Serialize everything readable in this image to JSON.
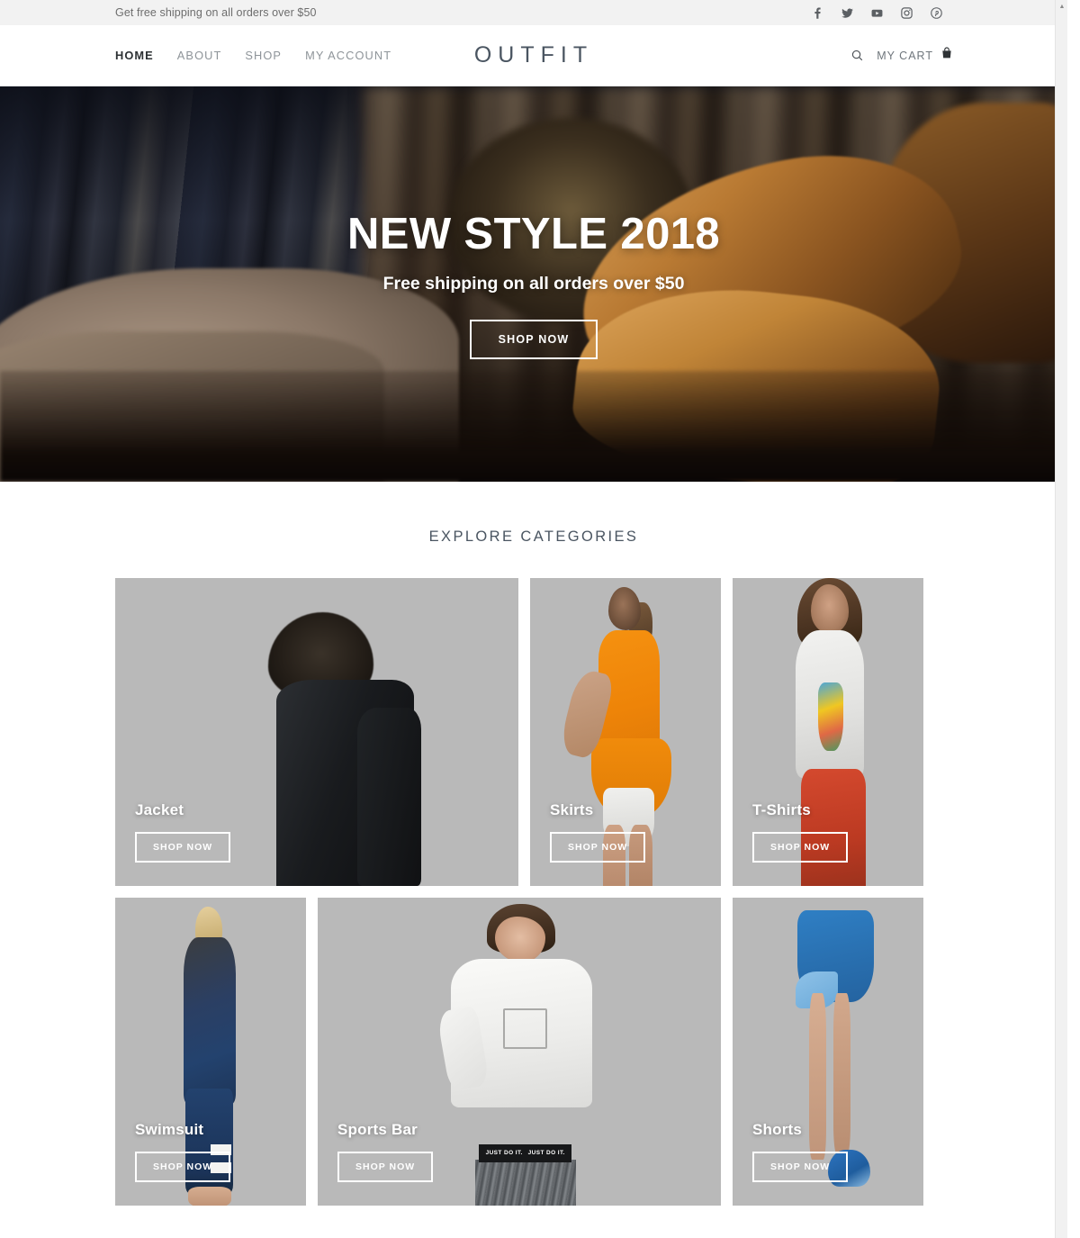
{
  "topbar": {
    "message": "Get free shipping on all orders over $50",
    "social": [
      {
        "name": "facebook-icon",
        "label": "f"
      },
      {
        "name": "twitter-icon",
        "label": "t"
      },
      {
        "name": "youtube-icon",
        "label": "yt"
      },
      {
        "name": "instagram-icon",
        "label": "ig"
      },
      {
        "name": "pinterest-icon",
        "label": "p"
      }
    ]
  },
  "nav": {
    "logo": "OUTFIT",
    "links": [
      {
        "label": "HOME",
        "active": true
      },
      {
        "label": "ABOUT",
        "active": false
      },
      {
        "label": "SHOP",
        "active": false
      },
      {
        "label": "MY ACCOUNT",
        "active": false
      }
    ],
    "search_label": "search-icon",
    "cart_label": "MY CART"
  },
  "hero": {
    "title": "NEW STYLE 2018",
    "subtitle": "Free shipping on all orders over $50",
    "button": "SHOP NOW"
  },
  "categories_section": {
    "title": "EXPLORE CATEGORIES",
    "row1": [
      {
        "label": "Jacket",
        "button": "SHOP NOW",
        "size": "wide"
      },
      {
        "label": "Skirts",
        "button": "SHOP NOW",
        "size": "narrow"
      },
      {
        "label": "T-Shirts",
        "button": "SHOP NOW",
        "size": "narrow"
      }
    ],
    "row2": [
      {
        "label": "Swimsuit",
        "button": "SHOP NOW",
        "size": "narrow"
      },
      {
        "label": "Sports Bar",
        "button": "SHOP NOW",
        "size": "wide"
      },
      {
        "label": "Shorts",
        "button": "SHOP NOW",
        "size": "narrow"
      }
    ]
  },
  "colors": {
    "topbar_bg": "#f2f2f2",
    "logo": "#4a5561",
    "nav_active": "#2c3033",
    "nav_inactive": "#8e9499",
    "card_bg": "#b8b8b8"
  },
  "scrollbar": {
    "up_arrow": "▲"
  },
  "overlay_text": {
    "just_do_it": "JUST DO IT."
  }
}
